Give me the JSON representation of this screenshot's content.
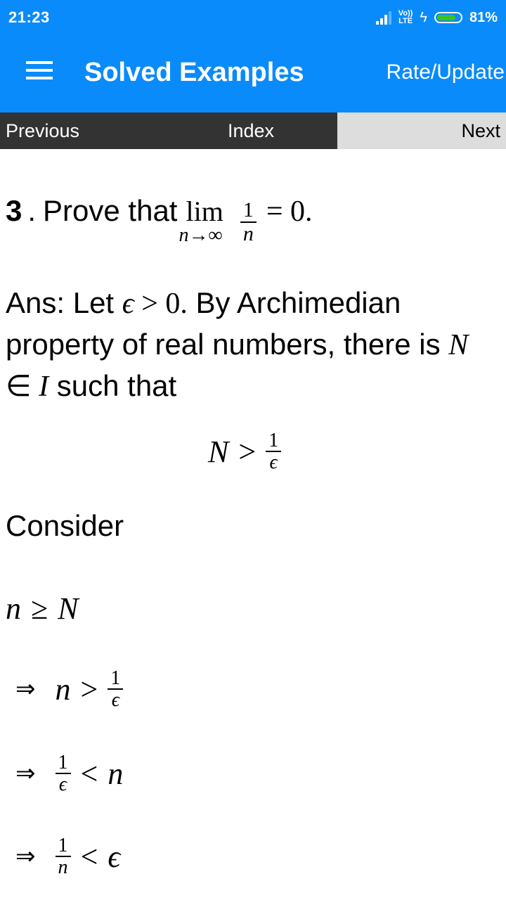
{
  "status_bar": {
    "time": "21:23",
    "network": "VoLTE",
    "lte_top": "Vo))",
    "lte_bottom": "LTE",
    "battery_percent": "81%",
    "battery_level": 0.81,
    "battery_color": "#3ec11f",
    "icons": [
      "signal-icon",
      "volte-icon",
      "charging-bolt-icon",
      "battery-icon"
    ]
  },
  "app_bar": {
    "title": "Solved Examples",
    "menu_icon": "hamburger-menu-icon",
    "action_label": "Rate/Update",
    "color": "#0a8bfb"
  },
  "nav": {
    "previous_label": "Previous",
    "index_label": "Index",
    "next_label": "Next"
  },
  "content": {
    "question": {
      "number": "3",
      "separator": ".",
      "text": "Prove that",
      "lim": "lim",
      "lim_sub": "n→∞",
      "frac_num": "1",
      "frac_den": "n",
      "tail": "= 0."
    },
    "answer": {
      "prefix": "Ans: Let ",
      "eps": "ϵ",
      "gt_zero": " > 0.",
      "text1": " By Archimedian property of real numbers, there is ",
      "N": "N",
      "in": " ∈ ",
      "I": "I",
      "text2": " such that"
    },
    "center_eq": {
      "lhs": "N",
      "op": ">",
      "num": "1",
      "den": "ϵ"
    },
    "consider": "Consider",
    "steps": [
      {
        "implies": "",
        "lhs": "n",
        "op": "≥",
        "rhs": "N"
      },
      {
        "implies": "⇒",
        "lhs": "n",
        "op": ">",
        "num": "1",
        "den": "ϵ"
      },
      {
        "implies": "⇒",
        "num": "1",
        "den": "ϵ",
        "op": "<",
        "rhs": "n"
      },
      {
        "implies": "⇒",
        "num": "1",
        "den": "n",
        "op": "<",
        "rhs": "ϵ"
      }
    ]
  }
}
